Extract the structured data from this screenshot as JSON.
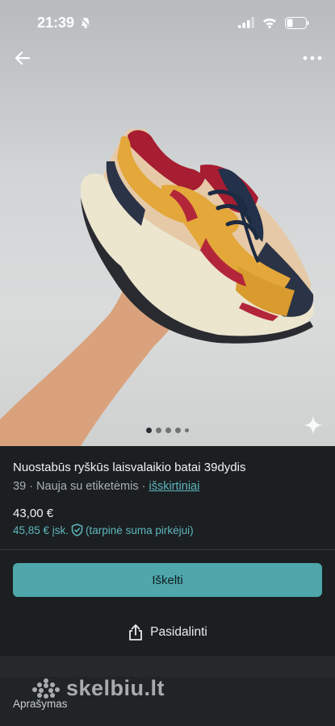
{
  "status_bar": {
    "time": "21:39"
  },
  "listing": {
    "title": "Nuostabūs ryškūs laisvalaikio batai 39dydis",
    "size": "39",
    "condition": "Nauja su etiketėmis",
    "separator": "·",
    "brand": "išskirtiniai",
    "price": "43,00 €",
    "price_incl": "45,85 € įsk.",
    "price_incl_note": "(tarpinė suma pirkėjui)"
  },
  "gallery": {
    "image_count": 5,
    "active_index": 0
  },
  "actions": {
    "primary_label": "Iškelti",
    "share_label": "Pasidalinti"
  },
  "section": {
    "description_label": "Aprašymas"
  },
  "watermark": {
    "text": "skelbiu.lt"
  },
  "colors": {
    "accent": "#4fa6ab",
    "link": "#5fb7be",
    "background": "#1b1f22"
  }
}
